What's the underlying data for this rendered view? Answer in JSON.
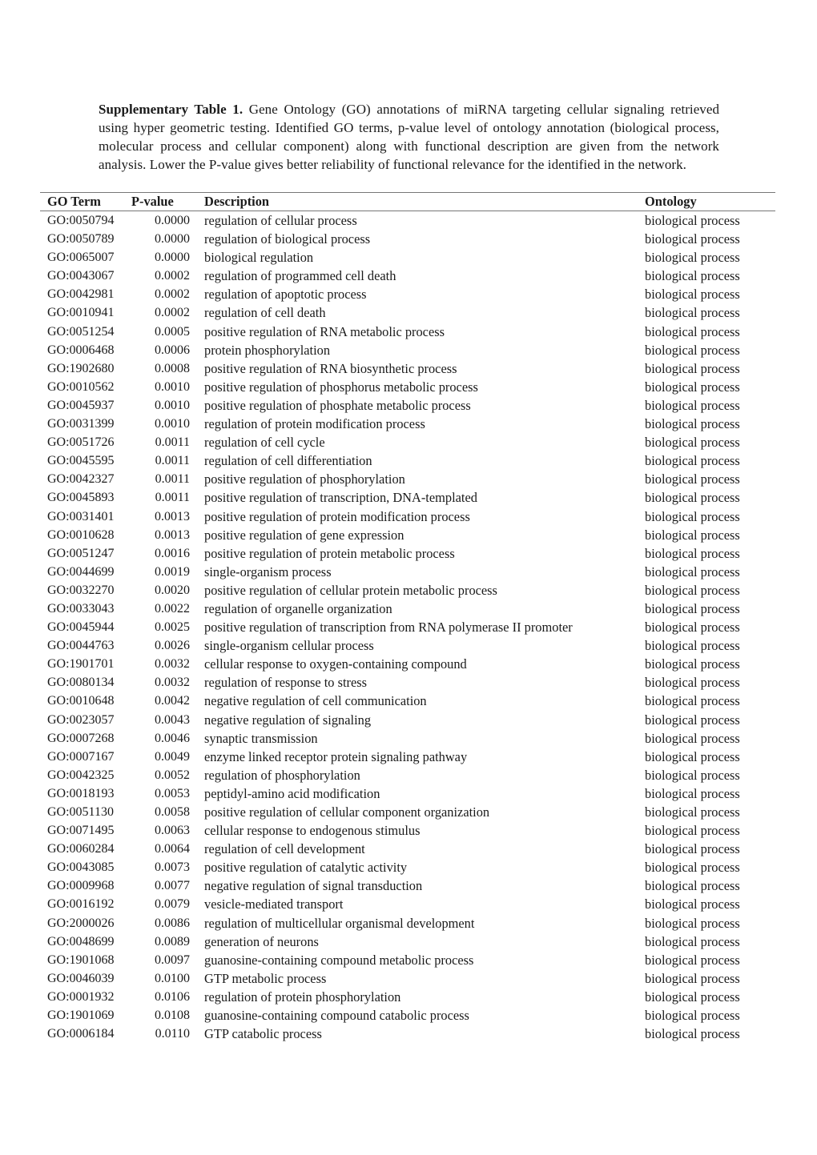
{
  "caption": {
    "lead": "Supplementary Table 1.",
    "text": " Gene Ontology (GO) annotations of miRNA targeting cellular signaling retrieved using hyper geometric testing. Identified GO terms, p-value level of ontology annotation (biological process, molecular process and cellular component) along with functional description are given from the network analysis. Lower the P-value gives better reliability of functional relevance for the identified in the network."
  },
  "table": {
    "headers": {
      "term": "GO Term",
      "pvalue": "P-value",
      "description": "Description",
      "ontology": "Ontology"
    },
    "rows": [
      {
        "term": "GO:0050794",
        "pvalue": "0.0000",
        "description": "regulation of cellular process",
        "ontology": "biological process"
      },
      {
        "term": "GO:0050789",
        "pvalue": "0.0000",
        "description": "regulation of biological process",
        "ontology": "biological process"
      },
      {
        "term": "GO:0065007",
        "pvalue": "0.0000",
        "description": "biological regulation",
        "ontology": "biological process"
      },
      {
        "term": "GO:0043067",
        "pvalue": "0.0002",
        "description": "regulation of programmed cell death",
        "ontology": "biological process"
      },
      {
        "term": "GO:0042981",
        "pvalue": "0.0002",
        "description": "regulation of apoptotic process",
        "ontology": "biological process"
      },
      {
        "term": "GO:0010941",
        "pvalue": "0.0002",
        "description": "regulation of cell death",
        "ontology": "biological process"
      },
      {
        "term": "GO:0051254",
        "pvalue": "0.0005",
        "description": "positive regulation of RNA metabolic process",
        "ontology": "biological process"
      },
      {
        "term": "GO:0006468",
        "pvalue": "0.0006",
        "description": "protein phosphorylation",
        "ontology": "biological process"
      },
      {
        "term": "GO:1902680",
        "pvalue": "0.0008",
        "description": "positive regulation of RNA biosynthetic process",
        "ontology": "biological process"
      },
      {
        "term": "GO:0010562",
        "pvalue": "0.0010",
        "description": "positive regulation of phosphorus metabolic process",
        "ontology": "biological process"
      },
      {
        "term": "GO:0045937",
        "pvalue": "0.0010",
        "description": "positive regulation of phosphate metabolic process",
        "ontology": "biological process"
      },
      {
        "term": "GO:0031399",
        "pvalue": "0.0010",
        "description": "regulation of protein modification process",
        "ontology": "biological process"
      },
      {
        "term": "GO:0051726",
        "pvalue": "0.0011",
        "description": "regulation of cell cycle",
        "ontology": "biological process"
      },
      {
        "term": "GO:0045595",
        "pvalue": "0.0011",
        "description": "regulation of cell differentiation",
        "ontology": "biological process"
      },
      {
        "term": "GO:0042327",
        "pvalue": "0.0011",
        "description": "positive regulation of phosphorylation",
        "ontology": "biological process"
      },
      {
        "term": "GO:0045893",
        "pvalue": "0.0011",
        "description": "positive regulation of transcription,  DNA-templated",
        "ontology": "biological process"
      },
      {
        "term": "GO:0031401",
        "pvalue": "0.0013",
        "description": "positive regulation of protein modification process",
        "ontology": "biological process"
      },
      {
        "term": "GO:0010628",
        "pvalue": "0.0013",
        "description": "positive regulation of gene expression",
        "ontology": "biological process"
      },
      {
        "term": "GO:0051247",
        "pvalue": "0.0016",
        "description": "positive regulation of protein metabolic process",
        "ontology": "biological process"
      },
      {
        "term": "GO:0044699",
        "pvalue": "0.0019",
        "description": "single-organism process",
        "ontology": "biological process"
      },
      {
        "term": "GO:0032270",
        "pvalue": "0.0020",
        "description": "positive regulation of cellular protein metabolic process",
        "ontology": "biological process"
      },
      {
        "term": "GO:0033043",
        "pvalue": "0.0022",
        "description": "regulation of organelle organization",
        "ontology": "biological process"
      },
      {
        "term": "GO:0045944",
        "pvalue": "0.0025",
        "description": "positive regulation of transcription from RNA polymerase II promoter",
        "ontology": "biological process"
      },
      {
        "term": "GO:0044763",
        "pvalue": "0.0026",
        "description": "single-organism cellular process",
        "ontology": "biological process"
      },
      {
        "term": "GO:1901701",
        "pvalue": "0.0032",
        "description": "cellular response to oxygen-containing compound",
        "ontology": "biological process"
      },
      {
        "term": "GO:0080134",
        "pvalue": "0.0032",
        "description": "regulation of response to stress",
        "ontology": "biological process"
      },
      {
        "term": "GO:0010648",
        "pvalue": "0.0042",
        "description": "negative regulation of cell communication",
        "ontology": "biological process"
      },
      {
        "term": "GO:0023057",
        "pvalue": "0.0043",
        "description": "negative regulation of signaling",
        "ontology": "biological process"
      },
      {
        "term": "GO:0007268",
        "pvalue": "0.0046",
        "description": "synaptic transmission",
        "ontology": "biological process"
      },
      {
        "term": "GO:0007167",
        "pvalue": "0.0049",
        "description": "enzyme linked receptor protein signaling pathway",
        "ontology": "biological process"
      },
      {
        "term": "GO:0042325",
        "pvalue": "0.0052",
        "description": "regulation of phosphorylation",
        "ontology": "biological process"
      },
      {
        "term": "GO:0018193",
        "pvalue": "0.0053",
        "description": "peptidyl-amino acid modification",
        "ontology": "biological process"
      },
      {
        "term": "GO:0051130",
        "pvalue": "0.0058",
        "description": "positive regulation of cellular component organization",
        "ontology": "biological process"
      },
      {
        "term": "GO:0071495",
        "pvalue": "0.0063",
        "description": "cellular response to endogenous stimulus",
        "ontology": "biological process"
      },
      {
        "term": "GO:0060284",
        "pvalue": "0.0064",
        "description": "regulation of cell development",
        "ontology": "biological process"
      },
      {
        "term": "GO:0043085",
        "pvalue": "0.0073",
        "description": "positive regulation of catalytic activity",
        "ontology": "biological process"
      },
      {
        "term": "GO:0009968",
        "pvalue": "0.0077",
        "description": "negative regulation of signal transduction",
        "ontology": "biological process"
      },
      {
        "term": "GO:0016192",
        "pvalue": "0.0079",
        "description": "vesicle-mediated transport",
        "ontology": "biological process"
      },
      {
        "term": "GO:2000026",
        "pvalue": "0.0086",
        "description": "regulation of multicellular organismal development",
        "ontology": "biological process"
      },
      {
        "term": "GO:0048699",
        "pvalue": "0.0089",
        "description": "generation of neurons",
        "ontology": "biological process"
      },
      {
        "term": "GO:1901068",
        "pvalue": "0.0097",
        "description": "guanosine-containing compound metabolic process",
        "ontology": "biological process"
      },
      {
        "term": "GO:0046039",
        "pvalue": "0.0100",
        "description": "GTP metabolic process",
        "ontology": "biological process"
      },
      {
        "term": "GO:0001932",
        "pvalue": "0.0106",
        "description": "regulation of protein phosphorylation",
        "ontology": "biological process"
      },
      {
        "term": "GO:1901069",
        "pvalue": "0.0108",
        "description": "guanosine-containing compound catabolic process",
        "ontology": "biological process"
      },
      {
        "term": "GO:0006184",
        "pvalue": "0.0110",
        "description": "GTP catabolic process",
        "ontology": "biological process"
      }
    ]
  }
}
